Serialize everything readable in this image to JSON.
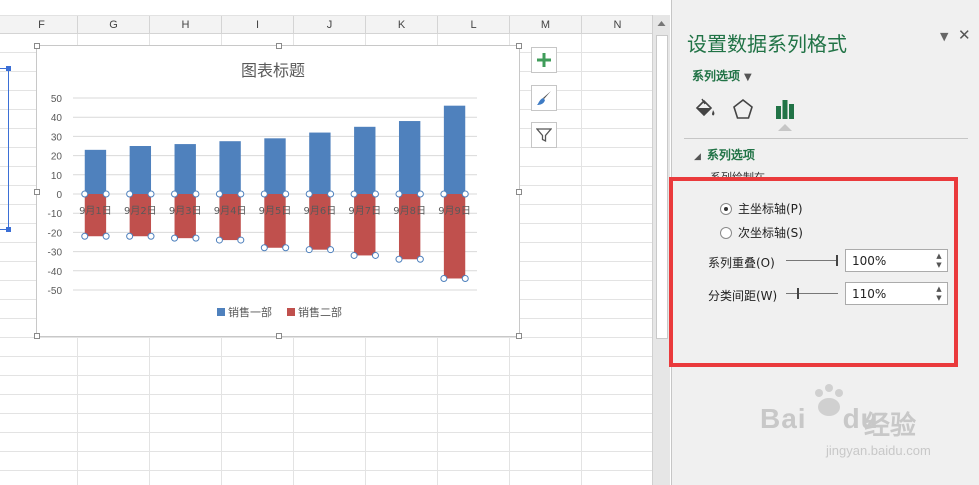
{
  "sheet": {
    "columns": [
      "F",
      "G",
      "H",
      "I",
      "J",
      "K",
      "L",
      "M",
      "N"
    ]
  },
  "chart": {
    "title": "图表标题",
    "y_ticks": [
      "50",
      "40",
      "30",
      "20",
      "10",
      "0",
      "-10",
      "-20",
      "-30",
      "-40",
      "-50"
    ],
    "legend": [
      {
        "label": "销售一部",
        "color": "#4f81bd"
      },
      {
        "label": "销售二部",
        "color": "#c0504d"
      }
    ]
  },
  "chart_data": {
    "type": "bar",
    "title": "图表标题",
    "categories": [
      "9月1日",
      "9月2日",
      "9月3日",
      "9月4日",
      "9月5日",
      "9月6日",
      "9月7日",
      "9月8日",
      "9月9日"
    ],
    "series": [
      {
        "name": "销售一部",
        "color": "#4f81bd",
        "values": [
          23,
          25,
          26,
          27.5,
          29,
          32,
          35,
          38,
          46
        ]
      },
      {
        "name": "销售二部",
        "color": "#c0504d",
        "values": [
          -22,
          -22,
          -23,
          -24,
          -28,
          -29,
          -32,
          -34,
          -44
        ]
      }
    ],
    "ylim": [
      -50,
      50
    ],
    "y_step": 10,
    "grid": true,
    "legend_position": "bottom",
    "series_overlap": "100%",
    "gap_width": "110%"
  },
  "panel": {
    "title": "设置数据系列格式",
    "options_dropdown": "系列选项",
    "tabs": [
      {
        "icon": "paint-bucket-icon"
      },
      {
        "icon": "pentagon-icon"
      },
      {
        "icon": "bar-chart-icon"
      }
    ],
    "section_header": "系列选项",
    "section_sublabel": "系列绘制在",
    "radio_primary": "主坐标轴(P)",
    "radio_secondary": "次坐标轴(S)",
    "overlap_label": "系列重叠(O)",
    "overlap_value": "100%",
    "overlap_fraction": 1.0,
    "gap_label": "分类间距(W)",
    "gap_value": "110%",
    "gap_fraction": 0.22,
    "accent_color": "#217346",
    "highlight_color": "#ea3a3c"
  },
  "watermark": {
    "brand": "Bai",
    "brand2": "du",
    "cn": "经验",
    "url": "jingyan.baidu.com"
  }
}
